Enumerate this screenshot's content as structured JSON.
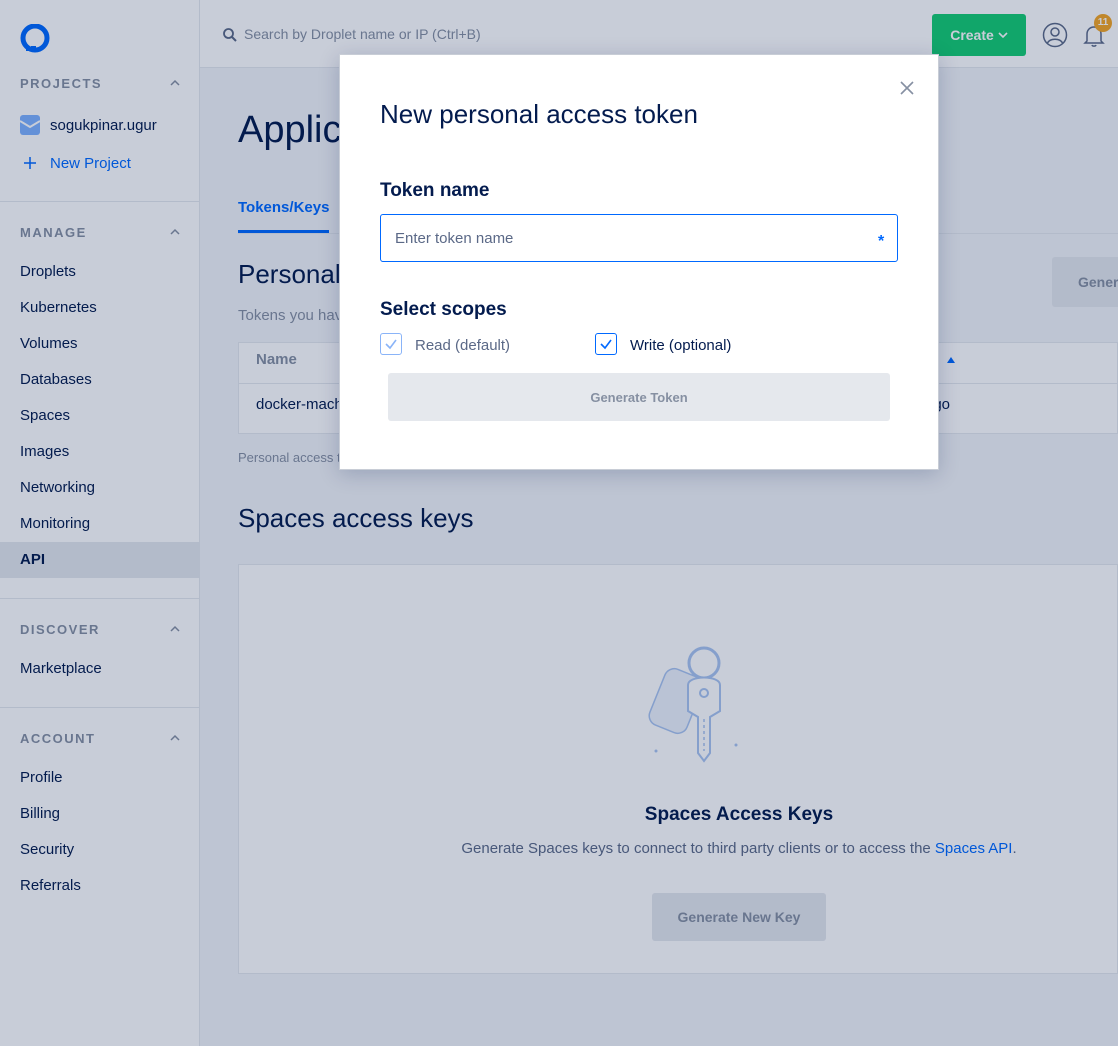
{
  "sidebar": {
    "projects_heading": "PROJECTS",
    "project_name": "sogukpinar.ugur",
    "new_project_label": "New Project",
    "manage_heading": "MANAGE",
    "manage_items": [
      "Droplets",
      "Kubernetes",
      "Volumes",
      "Databases",
      "Spaces",
      "Images",
      "Networking",
      "Monitoring",
      "API"
    ],
    "active_item": "API",
    "discover_heading": "DISCOVER",
    "discover_items": [
      "Marketplace"
    ],
    "account_heading": "ACCOUNT",
    "account_items": [
      "Profile",
      "Billing",
      "Security",
      "Referrals"
    ]
  },
  "topbar": {
    "search_placeholder": "Search by Droplet name or IP (Ctrl+B)",
    "create_label": "Create",
    "notification_count": "11"
  },
  "main": {
    "page_title": "Applications & API",
    "tab_tokens": "Tokens/Keys",
    "personal_title": "Personal access tokens",
    "personal_desc": "Tokens you have generated to access the DigitalOcean API.",
    "generate_token_label": "Generate New Token",
    "table_header_name": "Name",
    "token_row_name": "docker-machine",
    "token_row_created": "ago",
    "table_note": "Personal access tokens function like a combined name and password for API Authentication.",
    "spaces_title": "Spaces access keys",
    "empty_title": "Spaces Access Keys",
    "empty_desc_prefix": "Generate Spaces keys to connect to third party clients or to access the ",
    "empty_desc_link": "Spaces API",
    "empty_desc_suffix": ".",
    "generate_key_label": "Generate New Key"
  },
  "modal": {
    "title": "New personal access token",
    "token_name_label": "Token name",
    "token_name_placeholder": "Enter token name",
    "required_mark": "*",
    "scopes_label": "Select scopes",
    "scope_read": "Read (default)",
    "scope_write": "Write (optional)",
    "read_checked": true,
    "write_checked": true,
    "generate_label": "Generate Token"
  },
  "colors": {
    "brand_blue": "#0069ff",
    "create_green": "#15cd72",
    "text_dark": "#031b4e",
    "muted": "#8690a2"
  }
}
